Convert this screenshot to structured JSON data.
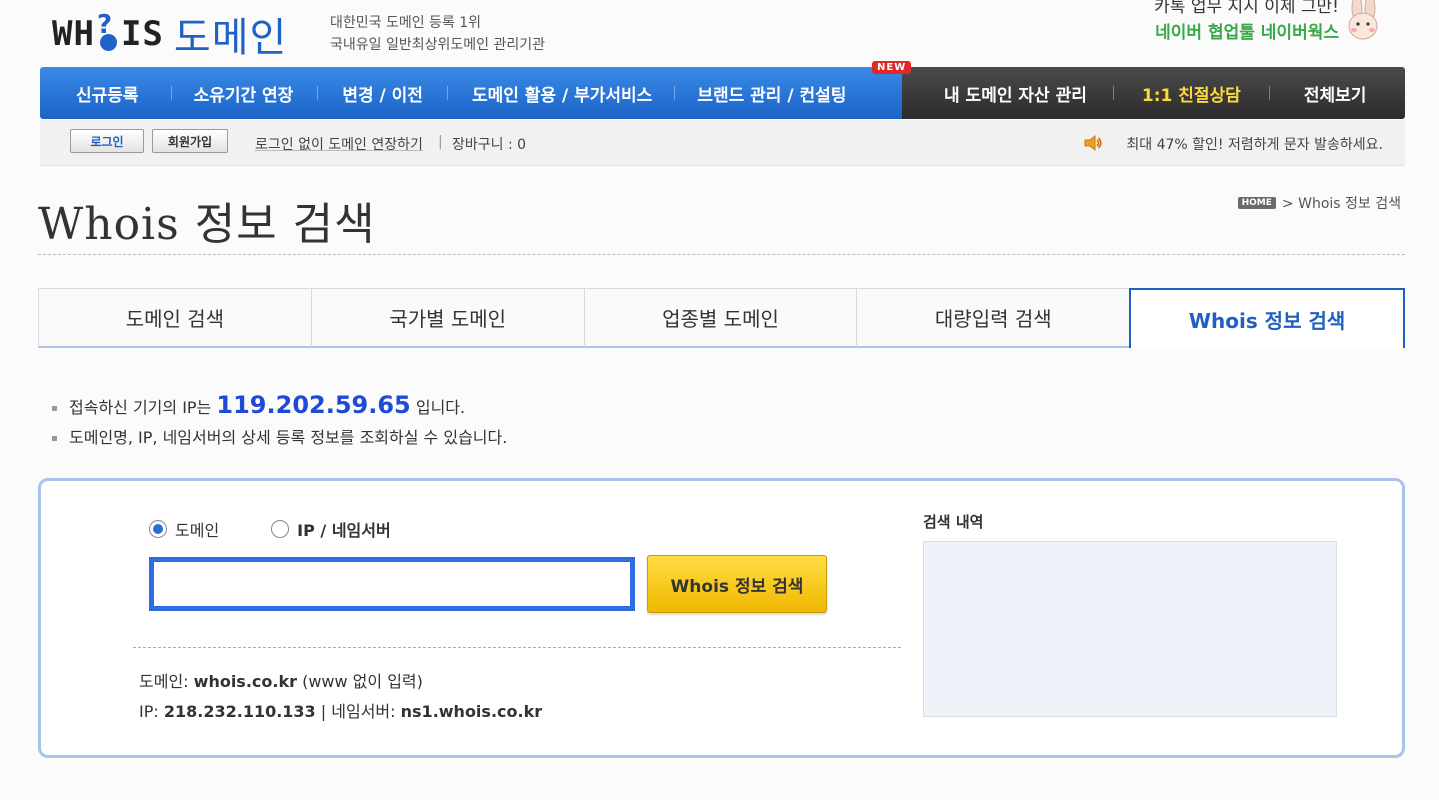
{
  "header": {
    "logo_whois_left": "WH",
    "logo_whois_right": "IS",
    "logo_domain": "도메인",
    "tagline_1": "대한민국 도메인 등록 1위",
    "tagline_2": "국내유일 일반최상위도메인 관리기관",
    "promo_1": "카톡 업무 지시 이제 그만!",
    "promo_2": "네이버 협업툴 네이버웍스"
  },
  "gnb": {
    "items": [
      {
        "label": "신규등록"
      },
      {
        "label": "소유기간 연장"
      },
      {
        "label": "변경 / 이전"
      },
      {
        "label": "도메인 활용 / 부가서비스"
      },
      {
        "label": "브랜드 관리 / 컨설팅"
      }
    ],
    "new_badge": "NEW",
    "dark_items": [
      {
        "label": "내 도메인 자산 관리"
      },
      {
        "label": "1:1 친절상담"
      },
      {
        "label": "전체보기"
      }
    ]
  },
  "util": {
    "login": "로그인",
    "join": "회원가입",
    "renew_link": "로그인 없이 도메인 연장하기",
    "separator": "|",
    "cart": "장바구니 : 0",
    "notice": "최대 47% 할인! 저렴하게 문자 발송하세요."
  },
  "page": {
    "title": "Whois 정보 검색",
    "breadcrumb_home": "HOME",
    "breadcrumb_current": "> Whois 정보 검색"
  },
  "tabs": [
    {
      "label": "도메인 검색"
    },
    {
      "label": "국가별 도메인"
    },
    {
      "label": "업종별 도메인"
    },
    {
      "label": "대량입력 검색"
    },
    {
      "label": "Whois 정보 검색"
    }
  ],
  "info": {
    "ip_prefix": "접속하신 기기의 IP는",
    "ip_value": "119.202.59.65",
    "ip_suffix": "입니다.",
    "line_2": "도메인명, IP, 네임서버의 상세 등록 정보를 조회하실 수 있습니다."
  },
  "search": {
    "radio_domain": "도메인",
    "radio_ip": "IP / 네임서버",
    "input_value": "",
    "button": "Whois 정보 검색",
    "ex_domain_label": "도메인:",
    "ex_domain_value": "whois.co.kr",
    "ex_domain_note": "(www 없이 입력)",
    "ex_ip_label": "IP:",
    "ex_ip_value": "218.232.110.133",
    "ex_sep": "|",
    "ex_ns_label": "네임서버:",
    "ex_ns_value": "ns1.whois.co.kr",
    "history_label": "검색 내역"
  },
  "colors": {
    "brand_blue": "#1f63c6",
    "accent_yellow": "#ffd93b",
    "ip_blue": "#1f4ad6"
  }
}
